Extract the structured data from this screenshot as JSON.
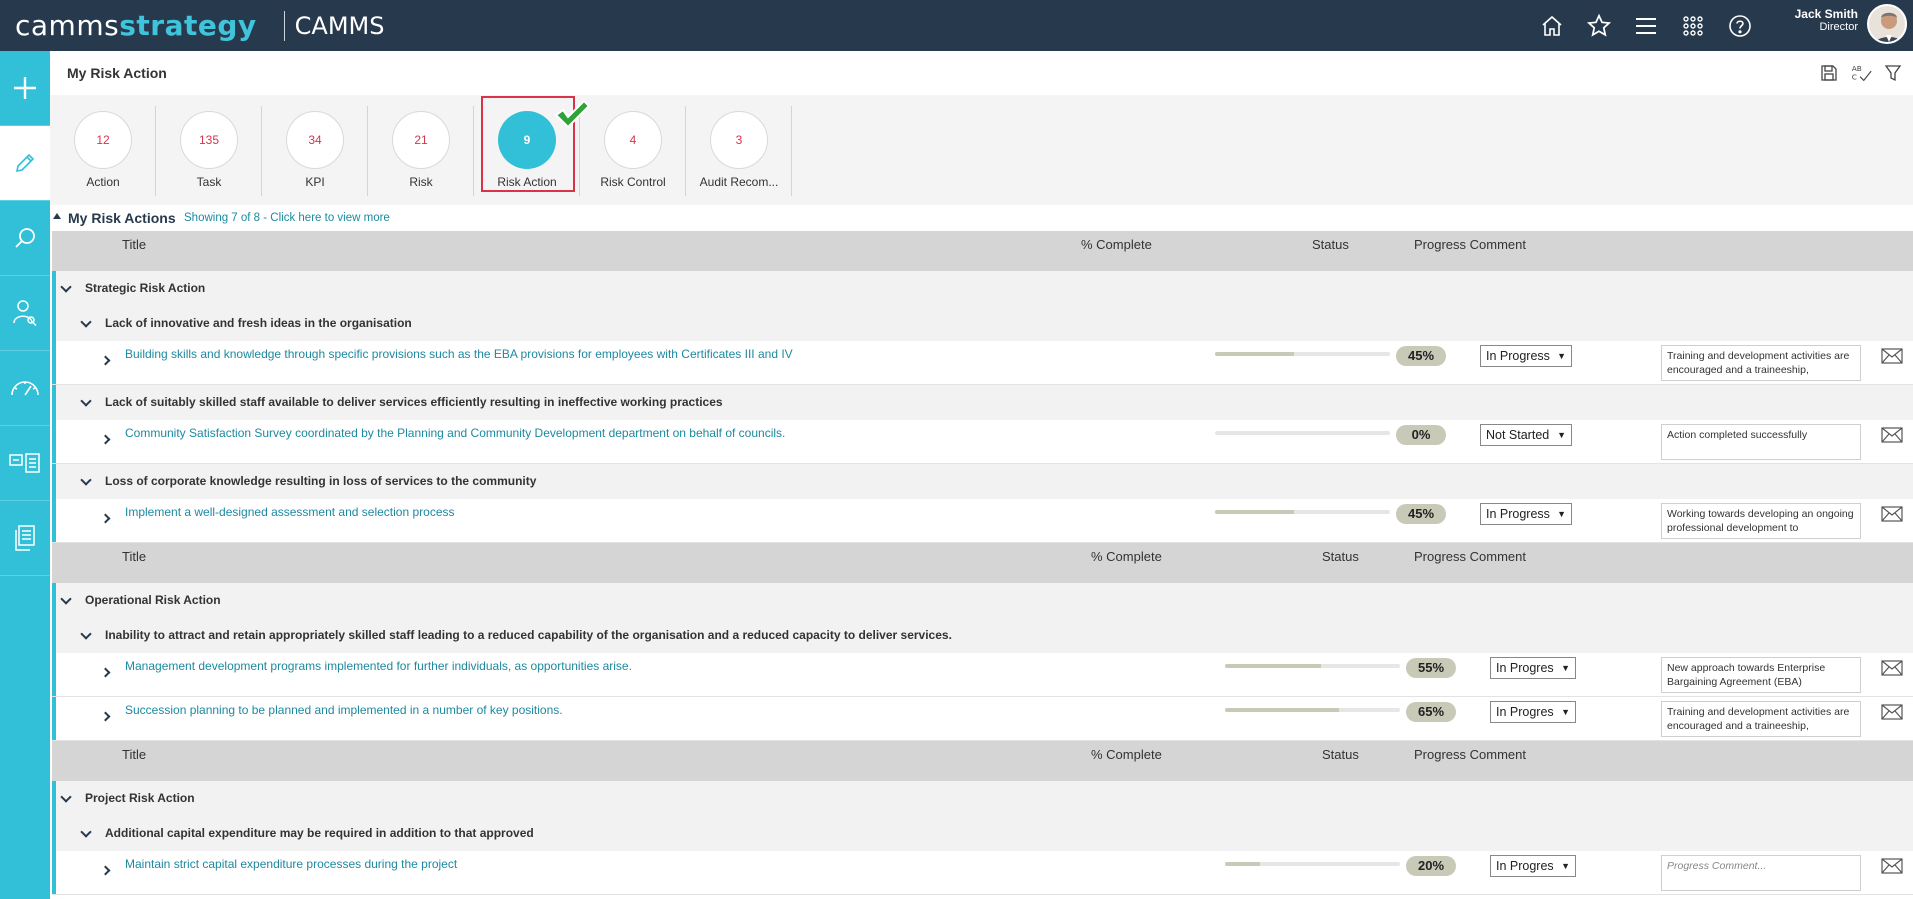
{
  "header": {
    "logo_prefix": "camms",
    "logo_accent": "strategy",
    "app_name": "CAMMS",
    "icons": [
      "home-icon",
      "star-icon",
      "menu-icon",
      "apps-grid-icon",
      "help-icon"
    ],
    "user": {
      "name": "Jack Smith",
      "role": "Director"
    }
  },
  "sidebar": {
    "items": [
      "plus-icon",
      "pencil-icon",
      "search-icon",
      "user-search-icon",
      "gauge-icon",
      "board-icon",
      "document-icon"
    ]
  },
  "page": {
    "title": "My Risk Action",
    "tools": [
      "save-icon",
      "spellcheck-icon",
      "filter-icon"
    ]
  },
  "tiles": [
    {
      "count": "12",
      "label": "Action"
    },
    {
      "count": "135",
      "label": "Task"
    },
    {
      "count": "34",
      "label": "KPI"
    },
    {
      "count": "21",
      "label": "Risk"
    },
    {
      "count": "9",
      "label": "Risk Action"
    },
    {
      "count": "4",
      "label": "Risk Control"
    },
    {
      "count": "3",
      "label": "Audit Recom..."
    }
  ],
  "section": {
    "title": "My Risk Actions",
    "subtitle": "Showing 7 of 8 - Click here to view more"
  },
  "columns": {
    "title": "Title",
    "complete": "% Complete",
    "status": "Status",
    "comment": "Progress Comment"
  },
  "groups": [
    {
      "name": "Strategic Risk Action",
      "risks": [
        {
          "name": "Lack of innovative and fresh ideas in the organisation",
          "actions": [
            {
              "title": "Building skills and knowledge through specific provisions such as the EBA provisions for employees with Certificates III and IV",
              "percent": 45,
              "percent_label": "45%",
              "status": "In Progress",
              "comment": "Training and development activities are encouraged and a traineeship,",
              "placeholder": false
            }
          ]
        },
        {
          "name": "Lack of suitably skilled staff available to deliver services efficiently resulting in ineffective working practices",
          "actions": [
            {
              "title": "Community Satisfaction Survey coordinated by the Planning and Community Development department on behalf of councils.",
              "percent": 0,
              "percent_label": "0%",
              "status": "Not Started",
              "comment": "Action completed successfully",
              "placeholder": false
            }
          ]
        },
        {
          "name": "Loss of corporate knowledge resulting in loss of services to the community",
          "actions": [
            {
              "title": "Implement a well-designed assessment and selection process",
              "percent": 45,
              "percent_label": "45%",
              "status": "In Progress",
              "comment": "Working towards developing an ongoing professional development to",
              "placeholder": false
            }
          ]
        }
      ]
    },
    {
      "name": "Operational Risk Action",
      "risks": [
        {
          "name": "Inability to attract and retain appropriately skilled staff leading to a reduced capability of the organisation and a reduced capacity to deliver services.",
          "actions": [
            {
              "title": "Management development programs implemented for further individuals, as opportunities arise.",
              "percent": 55,
              "percent_label": "55%",
              "status": "In Progres",
              "comment": "New approach towards Enterprise Bargaining Agreement (EBA)",
              "placeholder": false
            },
            {
              "title": "Succession planning to be planned and implemented in a number of key positions.",
              "percent": 65,
              "percent_label": "65%",
              "status": "In Progres",
              "comment": "Training and development activities are encouraged and a traineeship,",
              "placeholder": false
            }
          ]
        }
      ]
    },
    {
      "name": "Project Risk Action",
      "risks": [
        {
          "name": "Additional capital expenditure may be required in addition to that approved",
          "actions": [
            {
              "title": "Maintain strict capital expenditure processes during the project",
              "percent": 20,
              "percent_label": "20%",
              "status": "In Progres",
              "comment": "Progress Comment...",
              "placeholder": true
            }
          ]
        }
      ]
    }
  ]
}
